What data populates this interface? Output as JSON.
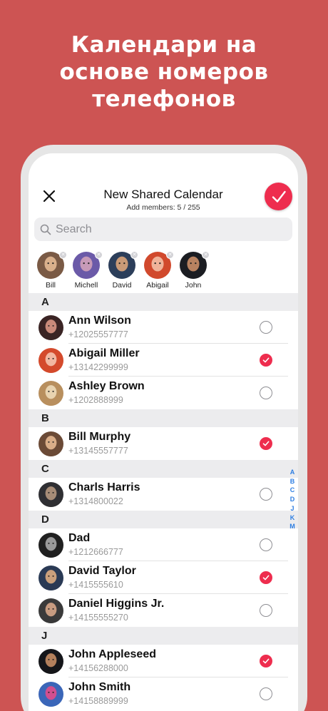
{
  "headline": {
    "line1": "Календари на",
    "line2": "основе номеров",
    "line3": "телефонов"
  },
  "header": {
    "title": "New Shared Calendar",
    "subtitle": "Add members: 5 / 255"
  },
  "search": {
    "placeholder": "Search"
  },
  "selected": [
    {
      "name": "Bill",
      "colors": [
        "#7a5a45",
        "#d9b08c"
      ]
    },
    {
      "name": "Michell",
      "colors": [
        "#6b5aa8",
        "#c79ab8"
      ]
    },
    {
      "name": "David",
      "colors": [
        "#2c3e5a",
        "#c99a77"
      ]
    },
    {
      "name": "Abigail",
      "colors": [
        "#d1492d",
        "#f0b39a"
      ]
    },
    {
      "name": "John",
      "colors": [
        "#1b1d22",
        "#b88260"
      ]
    }
  ],
  "contacts": {
    "A": {
      "letter": "A",
      "items": [
        {
          "name": "Ann Wilson",
          "phone": "+12025557777",
          "checked": false,
          "colors": [
            "#3a2424",
            "#c98a7a"
          ]
        },
        {
          "name": "Abigail Miller",
          "phone": "+13142299999",
          "checked": true,
          "colors": [
            "#d44a2c",
            "#f2b7a1"
          ]
        },
        {
          "name": "Ashley Brown",
          "phone": "+1202888999",
          "checked": false,
          "colors": [
            "#b88f5e",
            "#e8d3b0"
          ]
        }
      ]
    },
    "B": {
      "letter": "B",
      "items": [
        {
          "name": "Bill Murphy",
          "phone": "+13145557777",
          "checked": true,
          "colors": [
            "#6b4a36",
            "#d9ad88"
          ]
        }
      ]
    },
    "C": {
      "letter": "C",
      "items": [
        {
          "name": "Charls Harris",
          "phone": "+1314800022",
          "checked": false,
          "colors": [
            "#2f2f33",
            "#a78c77"
          ]
        }
      ]
    },
    "D": {
      "letter": "D",
      "items": [
        {
          "name": "Dad",
          "phone": "+1212666777",
          "checked": false,
          "colors": [
            "#202020",
            "#9a9a9a"
          ]
        },
        {
          "name": "David Taylor",
          "phone": "+1415555610",
          "checked": true,
          "colors": [
            "#2a3a55",
            "#caa07c"
          ]
        },
        {
          "name": "Daniel Higgins Jr.",
          "phone": "+14155555270",
          "checked": false,
          "colors": [
            "#3a3a3a",
            "#c79b80"
          ]
        }
      ]
    },
    "J": {
      "letter": "J",
      "items": [
        {
          "name": "John Appleseed",
          "phone": "+14156288000",
          "checked": true,
          "colors": [
            "#15161a",
            "#b3805c"
          ]
        },
        {
          "name": "John Smith",
          "phone": "+14158889999",
          "checked": false,
          "colors": [
            "#3b66b8",
            "#d04f8f"
          ]
        }
      ]
    }
  },
  "index_letters": [
    "A",
    "B",
    "C",
    "D",
    "J",
    "K",
    "M"
  ],
  "colors": {
    "background": "#cd5453",
    "accent": "#ee2d4e",
    "index": "#2d7ee2"
  }
}
